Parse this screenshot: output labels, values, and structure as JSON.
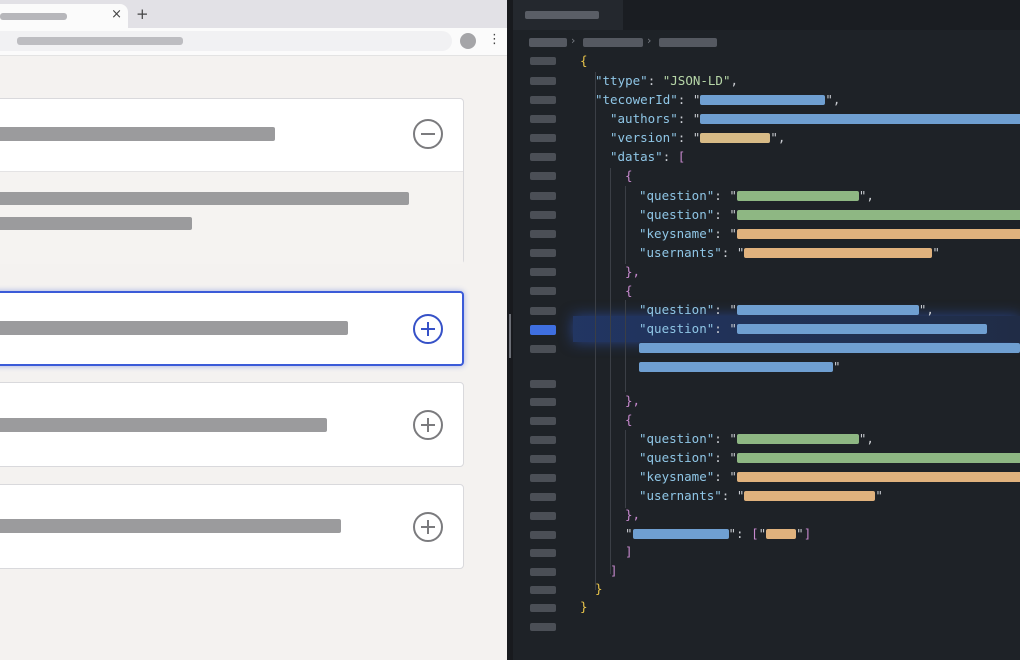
{
  "browser": {
    "tab_close_glyph": "×",
    "new_tab_glyph": "+",
    "menu_glyph": "⋮"
  },
  "faq": {
    "items": [
      {
        "state": "expanded",
        "toggle_icon": "minus-circle-icon"
      },
      {
        "state": "focused-collapsed",
        "toggle_icon": "plus-circle-icon"
      },
      {
        "state": "collapsed",
        "toggle_icon": "plus-circle-icon"
      },
      {
        "state": "collapsed",
        "toggle_icon": "plus-circle-icon"
      }
    ],
    "focus_color": "#3b5bd8"
  },
  "editor": {
    "colors": {
      "key": "#8fc6e6",
      "string": "#b7d7a8",
      "brace": "#e8c44a",
      "bracket": "#c688cd",
      "active_line": "#3f6fe0"
    },
    "lines": {
      "l1": "{",
      "l2_key": "\"ttype\"",
      "l2_val": "\"JSON-LD\"",
      "l3_key": "\"tecowerId\"",
      "l4_key": "\"authors\"",
      "l5_key": "\"version\"",
      "l6_key": "\"datas\"",
      "l6_open": "[",
      "obj_open": "{",
      "obj_close": "},",
      "key_question": "\"question\"",
      "key_keysname": "\"keysname\"",
      "key_usernants": "\"usernants\"",
      "arr_close": "]",
      "root_close": "}"
    }
  }
}
